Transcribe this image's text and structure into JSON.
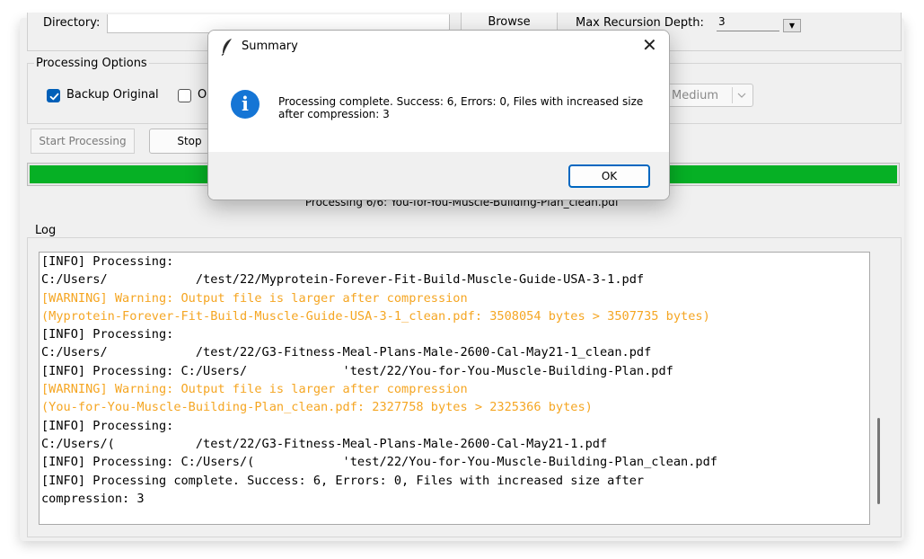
{
  "main": {
    "directory_label": "Directory:",
    "browse_label": "Browse",
    "max_recursion_label": "Max Recursion Depth:",
    "max_recursion_value": "3",
    "processing_options_title": "Processing Options",
    "backup_original_label": "Backup Original",
    "second_checkbox_label": "O",
    "quality_value": "Medium",
    "start_button": "Start Processing",
    "stop_button": "Stop",
    "progress_fraction": 1.0,
    "progress_text": "Processing 6/6: You-for-You-Muscle-Building-Plan_clean.pdf",
    "log_title": "Log"
  },
  "log": [
    {
      "level": "info",
      "text": "[INFO] Processing:"
    },
    {
      "level": "info",
      "text": "C:/Users/            /test/22/Myprotein-Forever-Fit-Build-Muscle-Guide-USA-3-1.pdf"
    },
    {
      "level": "warn",
      "text": "[WARNING] Warning: Output file is larger after compression"
    },
    {
      "level": "warn",
      "text": "(Myprotein-Forever-Fit-Build-Muscle-Guide-USA-3-1_clean.pdf: 3508054 bytes > 3507735 bytes)"
    },
    {
      "level": "info",
      "text": "[INFO] Processing:"
    },
    {
      "level": "info",
      "text": "C:/Users/            /test/22/G3-Fitness-Meal-Plans-Male-2600-Cal-May21-1_clean.pdf"
    },
    {
      "level": "info",
      "text": "[INFO] Processing: C:/Users/             'test/22/You-for-You-Muscle-Building-Plan.pdf"
    },
    {
      "level": "warn",
      "text": "[WARNING] Warning: Output file is larger after compression"
    },
    {
      "level": "warn",
      "text": "(You-for-You-Muscle-Building-Plan_clean.pdf: 2327758 bytes > 2325366 bytes)"
    },
    {
      "level": "info",
      "text": "[INFO] Processing:"
    },
    {
      "level": "info",
      "text": "C:/Users/(           /test/22/G3-Fitness-Meal-Plans-Male-2600-Cal-May21-1.pdf"
    },
    {
      "level": "info",
      "text": "[INFO] Processing: C:/Users/(            'test/22/You-for-You-Muscle-Building-Plan_clean.pdf"
    },
    {
      "level": "info",
      "text": "[INFO] Processing complete. Success: 6, Errors: 0, Files with increased size after"
    },
    {
      "level": "info",
      "text": "compression: 3"
    }
  ],
  "dialog": {
    "title": "Summary",
    "message": "Processing complete. Success: 6, Errors: 0, Files with increased size after compression: 3",
    "ok_label": "OK",
    "close_glyph": "✕",
    "icon_glyph": "i"
  },
  "colors": {
    "progress_green": "#06b025",
    "warning_orange": "#f5a623",
    "accent_blue": "#005fb8",
    "info_icon_blue": "#1575d5"
  },
  "icons": {
    "dialog_title_icon": "feather-icon",
    "dialog_info_icon": "info-icon",
    "spinbox_arrow": "chevron-down-icon",
    "combo_arrow": "chevron-down-icon"
  }
}
